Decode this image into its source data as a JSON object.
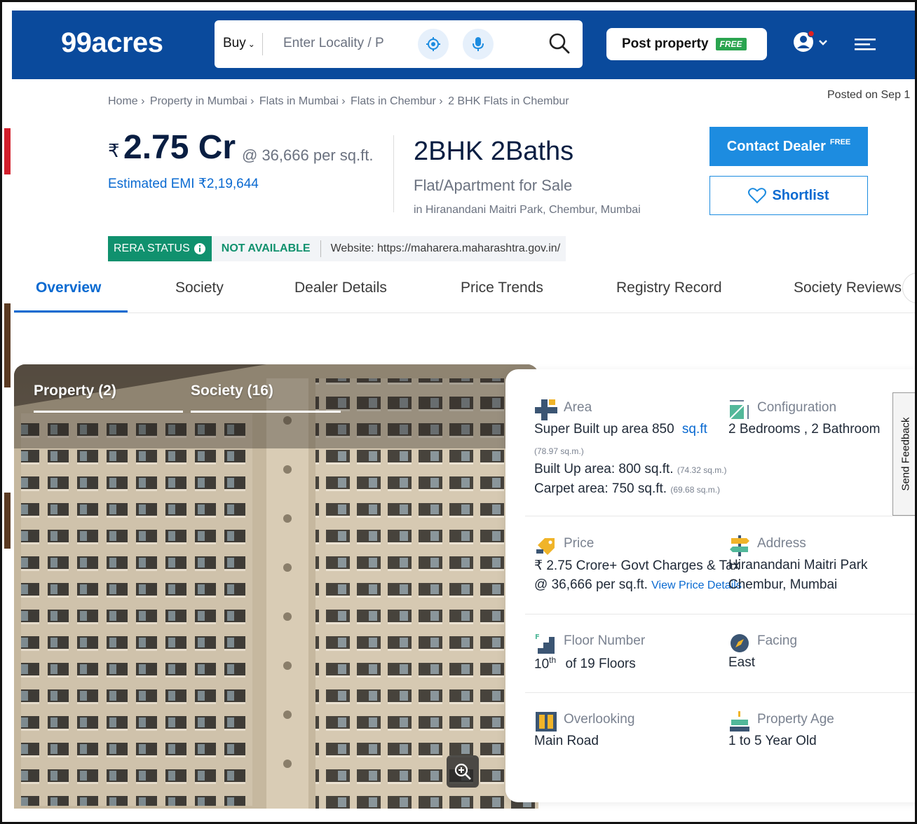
{
  "header": {
    "logo": "99acres",
    "search": {
      "mode": "Buy",
      "placeholder": "Enter Locality / P"
    },
    "post_property": "Post property",
    "post_badge": "FREE"
  },
  "breadcrumb": [
    "Home ›",
    "Property in Mumbai ›",
    "Flats in Mumbai ›",
    "Flats in Chembur ›",
    "2 BHK Flats in Chembur"
  ],
  "posted": "Posted on Sep 1",
  "listing": {
    "currency": "₹",
    "price": "2.75 Cr",
    "per_sqft": "@ 36,666 per sq.ft.",
    "emi": "Estimated EMI ₹2,19,644",
    "title": "2BHK 2Baths",
    "type": "Flat/Apartment for Sale",
    "location": "in Hiranandani Maitri Park, Chembur, Mumbai"
  },
  "actions": {
    "contact": "Contact Dealer",
    "contact_badge": "FREE",
    "shortlist": "Shortlist"
  },
  "rera": {
    "status_label": "RERA STATUS",
    "value": "NOT AVAILABLE",
    "website": "Website: https://maharera.maharashtra.gov.in/"
  },
  "tabs": [
    "Overview",
    "Society",
    "Dealer Details",
    "Price Trends",
    "Registry Record",
    "Society Reviews"
  ],
  "gallery": {
    "tab1": "Property (2)",
    "tab2": "Society (16)"
  },
  "details": {
    "area_label": "Area",
    "super_area": "Super Built up area 850",
    "super_unit": "sq.ft",
    "super_sqm": "(78.97 sq.m.)",
    "builtup": "Built Up area: 800 sq.ft.",
    "builtup_sqm": "(74.32 sq.m.)",
    "carpet": "Carpet area: 750 sq.ft.",
    "carpet_sqm": "(69.68 sq.m.)",
    "config_label": "Configuration",
    "config_value": "2 Bedrooms , 2 Bathroom",
    "price_label": "Price",
    "price_value": "₹ 2.75 Crore+ Govt Charges & Tax",
    "price_sqft": "@ 36,666 per sq.ft.",
    "price_link": "View Price Details",
    "address_label": "Address",
    "address_line1": "Hiranandani Maitri Park",
    "address_line2": "Chembur, Mumbai",
    "floor_label": "Floor Number",
    "floor_num": "10",
    "floor_sup": "th",
    "floor_total": "of 19 Floors",
    "facing_label": "Facing",
    "facing_value": "East",
    "overlooking_label": "Overlooking",
    "overlooking_value": "Main Road",
    "age_label": "Property Age",
    "age_value": "1 to 5 Year Old"
  },
  "feedback": "Send Feedback",
  "colors": {
    "brand": "#0a4a9c",
    "link": "#0a6ad1",
    "rera": "#10916e",
    "cta": "#1d8ce0"
  }
}
